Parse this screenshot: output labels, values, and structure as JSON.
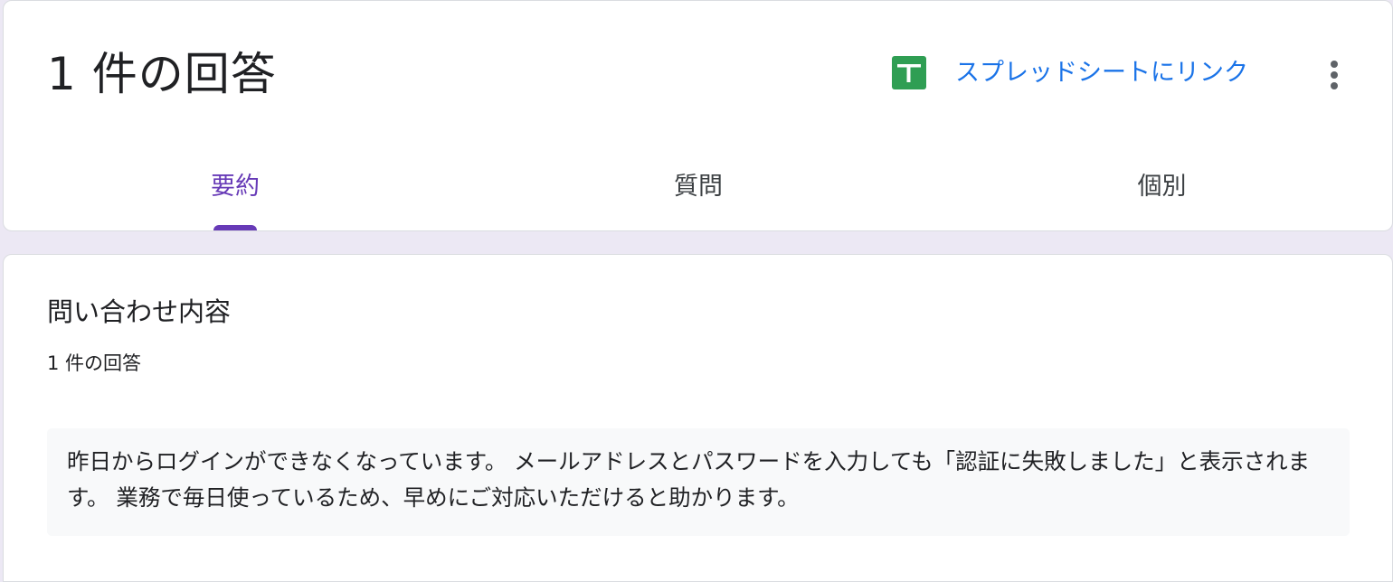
{
  "header": {
    "title": "1 件の回答",
    "sheets_link_label": "スプレッドシートにリンク",
    "sheets_icon": "google-sheets-icon",
    "more_icon": "more-vert-icon",
    "tabs": [
      {
        "label": "要約",
        "active": true
      },
      {
        "label": "質問",
        "active": false
      },
      {
        "label": "個別",
        "active": false
      }
    ]
  },
  "question": {
    "title": "問い合わせ内容",
    "response_count": "1 件の回答",
    "answers": [
      "昨日からログインができなくなっています。 メールアドレスとパスワードを入力しても「認証に失敗しました」と表示されます。 業務で毎日使っているため、早めにご対応いただけると助かります。"
    ]
  },
  "colors": {
    "accent_purple": "#673ab7",
    "link_blue": "#1a73e8",
    "sheets_green": "#0f9d58",
    "page_background": "#ece8f4"
  }
}
